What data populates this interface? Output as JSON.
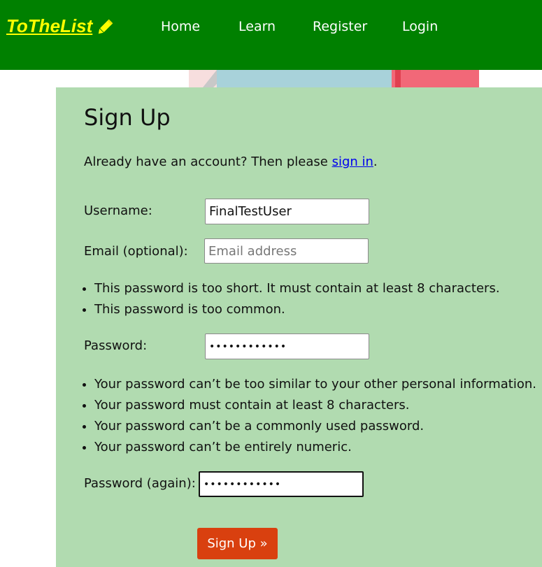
{
  "brand": {
    "name": "ToTheList",
    "icon": "pencil-icon",
    "color": "#ffff00"
  },
  "nav": {
    "home": "Home",
    "learn": "Learn",
    "register": "Register",
    "login": "Login"
  },
  "colors": {
    "navbar": "#008000",
    "panel": "#b1dbb0",
    "button": "#d9400f"
  },
  "form": {
    "title": "Sign Up",
    "intro_prefix": "Already have an account? Then please ",
    "intro_link": "sign in",
    "intro_suffix": ".",
    "username_label": "Username:",
    "username_value": "FinalTestUser",
    "email_label": "Email (optional):",
    "email_placeholder": "Email address",
    "password_errors": [
      "This password is too short. It must contain at least 8 characters.",
      "This password is too common."
    ],
    "password_label": "Password:",
    "password_value": "••••••••••••",
    "password_help": [
      "Your password can’t be too similar to your other personal information.",
      "Your password must contain at least 8 characters.",
      "Your password can’t be a commonly used password.",
      "Your password can’t be entirely numeric."
    ],
    "password2_label": "Password (again):",
    "password2_value": "••••••••••••",
    "submit_label": "Sign Up »"
  }
}
